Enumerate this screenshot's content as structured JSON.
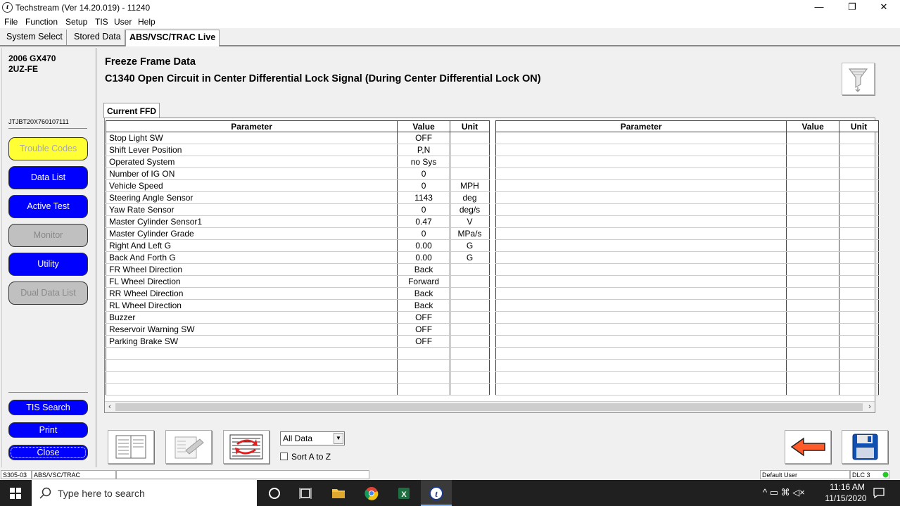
{
  "window": {
    "title": "Techstream (Ver 14.20.019) - 11240",
    "minimize": "—",
    "restore": "❐",
    "close": "✕"
  },
  "menu": [
    "File",
    "Function",
    "Setup",
    "TIS",
    "User",
    "Help"
  ],
  "tabs": [
    "System Select",
    "Stored Data",
    "ABS/VSC/TRAC Live"
  ],
  "vehicle": {
    "model": "2006 GX470",
    "engine": "2UZ-FE",
    "vin": "JTJBT20X760107111"
  },
  "nav": {
    "trouble_codes": "Trouble Codes",
    "data_list": "Data List",
    "active_test": "Active Test",
    "monitor": "Monitor",
    "utility": "Utility",
    "dual_data_list": "Dual Data List",
    "tis_search": "TIS Search",
    "print": "Print",
    "close": "Close"
  },
  "main": {
    "title": "Freeze Frame Data",
    "dtc": "C1340 Open Circuit in Center Differential Lock Signal (During Center Differential Lock ON)",
    "subtab": "Current FFD",
    "headers": {
      "parameter": "Parameter",
      "value": "Value",
      "unit": "Unit"
    },
    "rows": [
      {
        "parameter": "Stop Light SW",
        "value": "OFF",
        "unit": ""
      },
      {
        "parameter": "Shift Lever Position",
        "value": "P,N",
        "unit": ""
      },
      {
        "parameter": "Operated System",
        "value": "no Sys",
        "unit": ""
      },
      {
        "parameter": "Number of IG ON",
        "value": "0",
        "unit": ""
      },
      {
        "parameter": "Vehicle Speed",
        "value": "0",
        "unit": "MPH"
      },
      {
        "parameter": "Steering Angle Sensor",
        "value": "1143",
        "unit": "deg"
      },
      {
        "parameter": "Yaw Rate Sensor",
        "value": "0",
        "unit": "deg/s"
      },
      {
        "parameter": "Master Cylinder Sensor1",
        "value": "0.47",
        "unit": "V"
      },
      {
        "parameter": "Master Cylinder Grade",
        "value": "0",
        "unit": "MPa/s"
      },
      {
        "parameter": "Right And Left G",
        "value": "0.00",
        "unit": "G"
      },
      {
        "parameter": "Back And Forth G",
        "value": "0.00",
        "unit": "G"
      },
      {
        "parameter": "FR Wheel Direction",
        "value": "Back",
        "unit": ""
      },
      {
        "parameter": "FL Wheel Direction",
        "value": "Forward",
        "unit": ""
      },
      {
        "parameter": "RR Wheel Direction",
        "value": "Back",
        "unit": ""
      },
      {
        "parameter": "RL Wheel Direction",
        "value": "Back",
        "unit": ""
      },
      {
        "parameter": "Buzzer",
        "value": "OFF",
        "unit": ""
      },
      {
        "parameter": "Reservoir Warning SW",
        "value": "OFF",
        "unit": ""
      },
      {
        "parameter": "Parking Brake SW",
        "value": "OFF",
        "unit": ""
      }
    ],
    "empty_rows": 4,
    "right_empty_rows": 22,
    "filter_select": "All Data",
    "sort_label": "Sort A to Z"
  },
  "status": {
    "code": "S305-03",
    "system": "ABS/VSC/TRAC",
    "user": "Default User",
    "dlc": "DLC 3",
    "dlc_color": "#22cc22"
  },
  "taskbar": {
    "search_placeholder": "Type here to search",
    "time": "11:16 AM",
    "date": "11/15/2020",
    "tray_icons": "^ ▭ ⌘ ◁×"
  }
}
